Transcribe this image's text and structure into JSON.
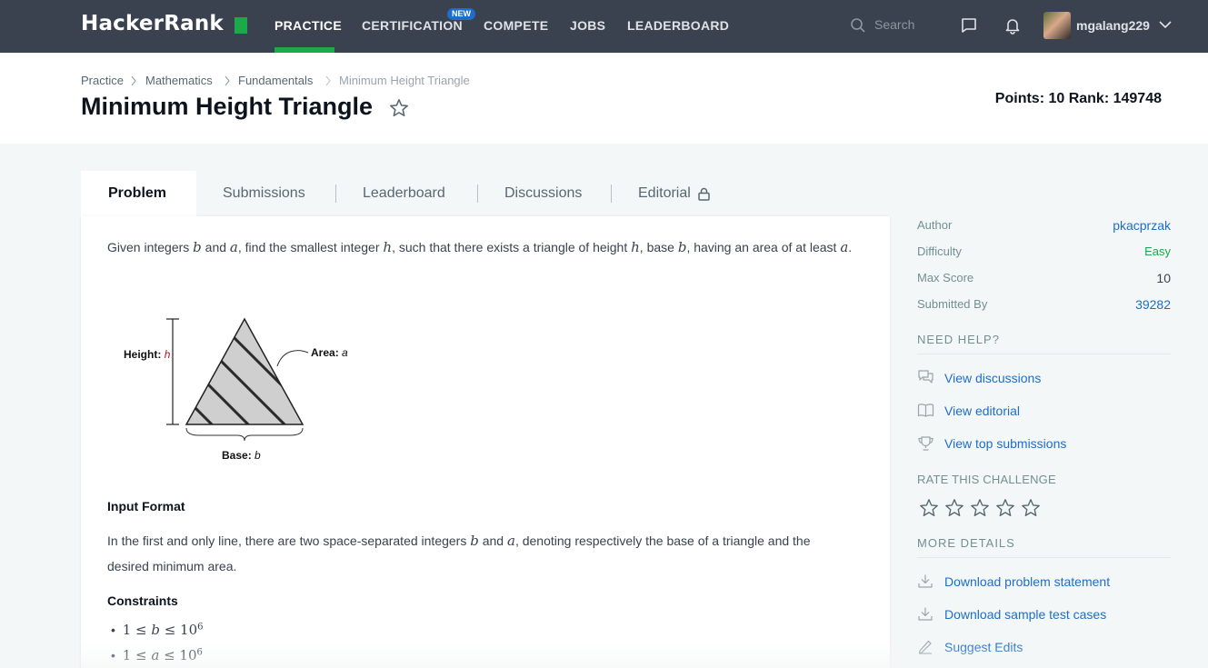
{
  "nav": {
    "logo": "HackerRank",
    "links": [
      "PRACTICE",
      "CERTIFICATION",
      "COMPETE",
      "JOBS",
      "LEADERBOARD"
    ],
    "new_badge": "NEW",
    "search_placeholder": "Search",
    "username": "mgalang229",
    "colors": {
      "bar": "#39424e",
      "accent": "#1ba94c",
      "badge": "#1d6ecb"
    },
    "icons": [
      "search-icon",
      "messages-icon",
      "bell-icon",
      "avatar",
      "chevron-down-icon"
    ]
  },
  "breadcrumb": [
    "Practice",
    "Mathematics",
    "Fundamentals",
    "Minimum Height Triangle"
  ],
  "title": "Minimum Height Triangle",
  "points_rank": "Points: 10  Rank: 149748",
  "tabs": [
    "Problem",
    "Submissions",
    "Leaderboard",
    "Discussions",
    "Editorial"
  ],
  "problem": {
    "intro_parts": [
      "Given integers ",
      "b",
      " and ",
      "a",
      ", find the smallest integer ",
      "h",
      ", such that there exists a triangle of height ",
      "h",
      ", base ",
      "b",
      ", having an area of at least ",
      "a",
      "."
    ],
    "figure": {
      "height_label": "Height",
      "height_var": "h",
      "area_label": "Area",
      "area_var": "a",
      "base_label": "Base",
      "base_var": "b"
    },
    "input_format_head": "Input Format",
    "input_format_parts": [
      "In the first and only line, there are two space-separated integers ",
      "b",
      " and ",
      "a",
      ", denoting respectively the base of a triangle and the desired minimum area."
    ],
    "constraints_head": "Constraints",
    "constraints": [
      {
        "lhs": "1 ≤ ",
        "var": "b",
        "rhs": " ≤ 10",
        "exp": "6"
      },
      {
        "lhs": "1 ≤ ",
        "var": "a",
        "rhs": " ≤ 10",
        "exp": "6"
      }
    ]
  },
  "sidebar": {
    "details": [
      {
        "label": "Author",
        "value": "pkacprzak"
      },
      {
        "label": "Difficulty",
        "value": "Easy"
      },
      {
        "label": "Max Score",
        "value": "10"
      },
      {
        "label": "Submitted By",
        "value": "39282"
      }
    ],
    "need_help_head": "NEED HELP?",
    "help_links": [
      "View discussions",
      "View editorial",
      "View top submissions"
    ],
    "rate_head": "RATE THIS CHALLENGE",
    "rating": 0,
    "more_head": "MORE DETAILS",
    "more_links": [
      "Download problem statement",
      "Download sample test cases",
      "Suggest Edits"
    ]
  }
}
